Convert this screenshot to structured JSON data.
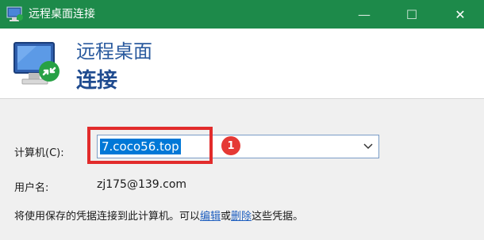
{
  "window": {
    "title": "远程桌面连接",
    "controls": {
      "minimize": "—",
      "maximize": "☐",
      "close": "✕"
    }
  },
  "header": {
    "line1": "远程桌面",
    "line2": "连接"
  },
  "form": {
    "computer_label": "计算机(C):",
    "computer_value": "7.coco56.top",
    "username_label": "用户名:",
    "username_value": "zj175@139.com"
  },
  "annotation": {
    "badge": "1",
    "highlight_color": "#e22b2b"
  },
  "info": {
    "prefix": "将使用保存的凭据连接到此计算机。可以",
    "edit_link": "编辑",
    "middle": "或",
    "delete_link": "删除",
    "suffix": "这些凭据。"
  },
  "colors": {
    "titlebar": "#1d8a4a",
    "selection": "#0078d7",
    "link": "#1f5fbf",
    "badge": "#e53935"
  },
  "icons": [
    "remote-desktop-icon",
    "chevron-down-icon"
  ]
}
